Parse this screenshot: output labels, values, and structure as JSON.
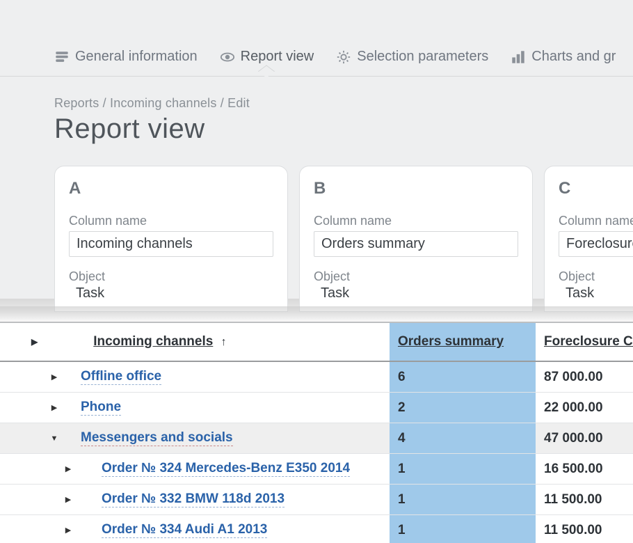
{
  "tabs": [
    {
      "id": "general",
      "label": "General information"
    },
    {
      "id": "report",
      "label": "Report view"
    },
    {
      "id": "selection",
      "label": "Selection parameters"
    },
    {
      "id": "charts",
      "label": "Charts and gr"
    }
  ],
  "active_tab": "report",
  "breadcrumb": "Reports / Incoming channels / Edit",
  "page_title": "Report view",
  "columns": [
    {
      "letter": "A",
      "name_label": "Column name",
      "name_value": "Incoming channels",
      "object_label": "Object",
      "object_value": "Task"
    },
    {
      "letter": "B",
      "name_label": "Column name",
      "name_value": "Orders summary",
      "object_label": "Object",
      "object_value": "Task"
    },
    {
      "letter": "C",
      "name_label": "Column name",
      "name_value": "Foreclosure Co",
      "object_label": "Object",
      "object_value": "Task"
    }
  ],
  "table": {
    "headers": {
      "a": "Incoming channels",
      "sort_indicator": "↑",
      "b": "Orders summary",
      "c": "Foreclosure Co"
    },
    "rows": [
      {
        "level": 1,
        "expanded": false,
        "label": "Offline office",
        "orders": "6",
        "foreclosure": "87 000.00"
      },
      {
        "level": 1,
        "expanded": false,
        "label": "Phone",
        "orders": "2",
        "foreclosure": "22 000.00"
      },
      {
        "level": 1,
        "expanded": true,
        "selected": true,
        "label": "Messengers and socials",
        "orders": "4",
        "foreclosure": "47 000.00"
      },
      {
        "level": 2,
        "expanded": false,
        "label": "Order № 324 Mercedes-Benz E350 2014",
        "orders": "1",
        "foreclosure": "16 500.00"
      },
      {
        "level": 2,
        "expanded": false,
        "label": "Order № 332 BMW 118d 2013",
        "orders": "1",
        "foreclosure": "11 500.00"
      },
      {
        "level": 2,
        "expanded": false,
        "label": "Order № 334 Audi A1 2013",
        "orders": "1",
        "foreclosure": "11 500.00"
      }
    ]
  }
}
